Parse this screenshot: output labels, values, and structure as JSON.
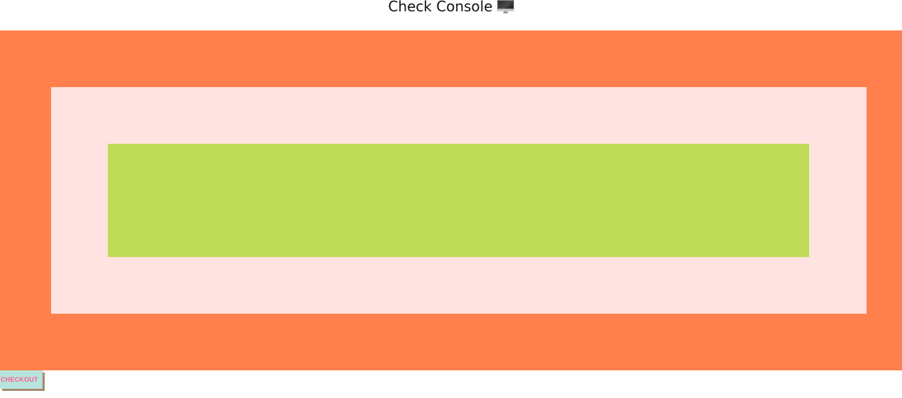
{
  "header": {
    "title": "Check Console",
    "icon": "desktop-computer-icon"
  },
  "boxes": {
    "outer": {
      "color": "#ff7f4d"
    },
    "middle": {
      "color": "#ffe3e1"
    },
    "inner": {
      "color": "#bfdb58"
    }
  },
  "checkout": {
    "label": "CHECKOUT",
    "text_color": "#ff5d8f",
    "background": "#b7e4dd",
    "shadow_color": "#a7886e"
  }
}
